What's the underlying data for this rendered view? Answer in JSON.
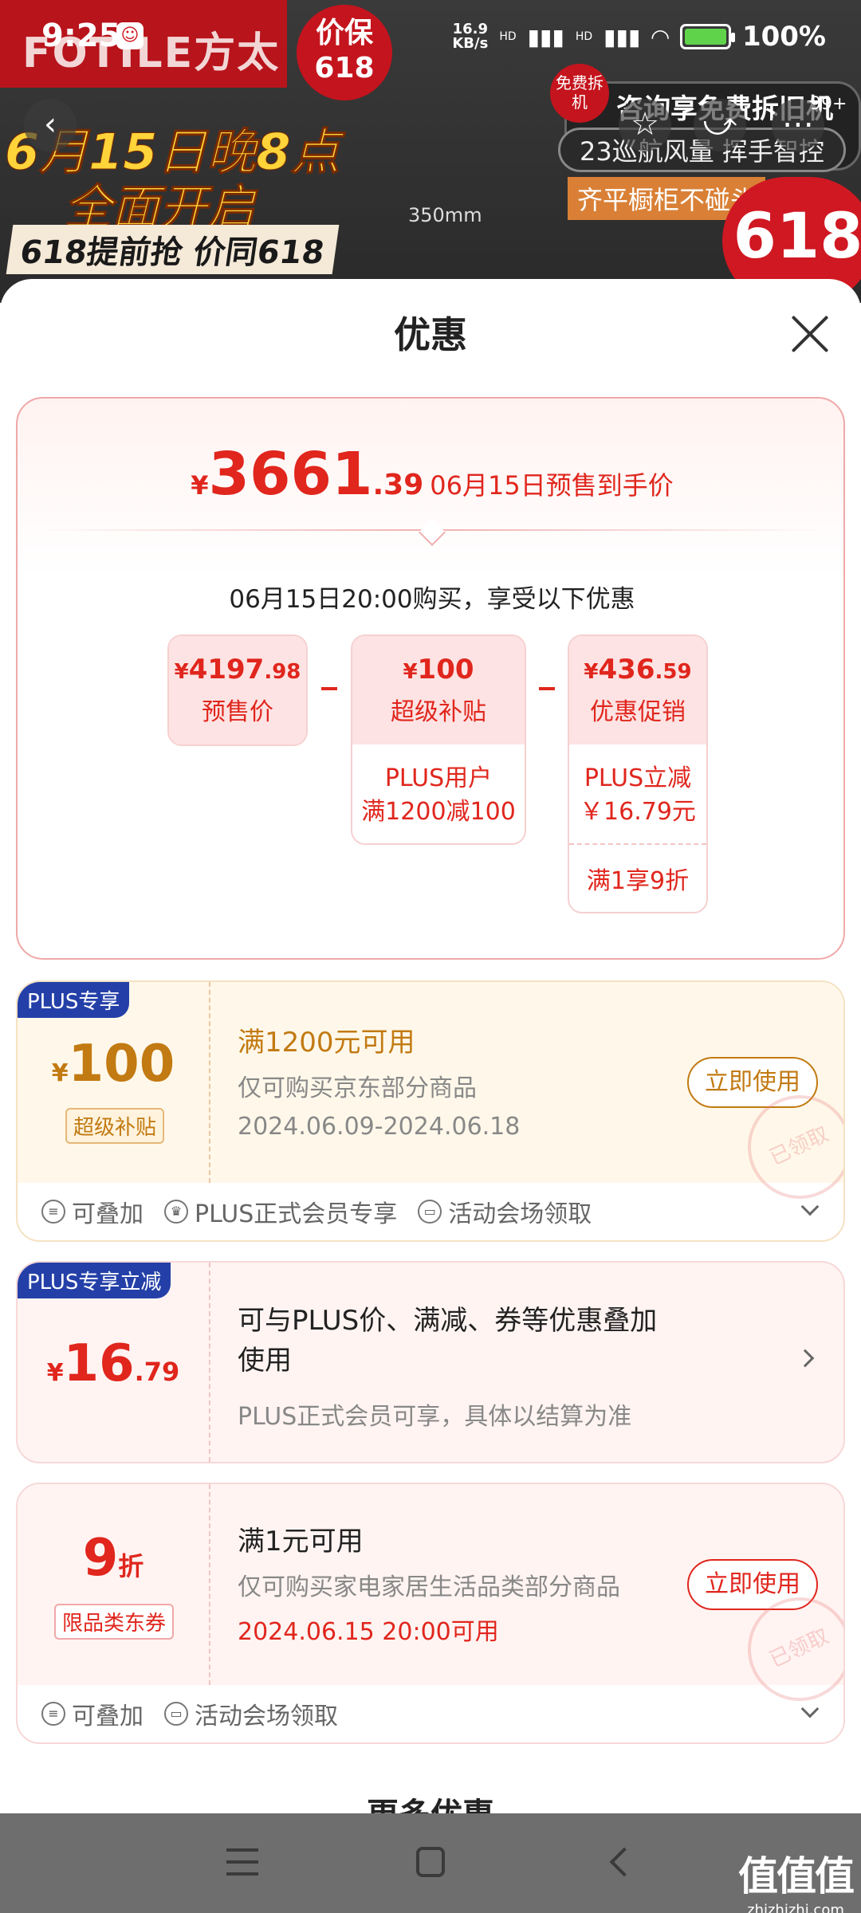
{
  "status_bar": {
    "time": "9:25",
    "net_speed_value": "16.9",
    "net_speed_unit": "KB/s",
    "signal1": "HD",
    "signal2": "HD",
    "battery": "100%",
    "battery_level": 1.0
  },
  "banner": {
    "brand": "FOTILE方太",
    "badge_top": "价保",
    "badge_bottom": "618",
    "date_line": "6月15日晚8点",
    "open_line": "全面开启",
    "sub_line": "618提前抢 价同618",
    "size": "350mm",
    "free_badge": "免费拆机",
    "ad_line1": "咨询享免费拆旧机服务",
    "ad_line2": "23巡航风量 挥手智控",
    "ad_line3": "齐平橱柜不碰头",
    "big_badge": "618",
    "more_badge": "99+"
  },
  "sheet": {
    "title": "优惠"
  },
  "summary": {
    "currency": "¥",
    "price_int": "3661",
    "price_dec": ".39",
    "price_desc": "06月15日预售到手价",
    "buy_note": "06月15日20:00购买，享受以下优惠",
    "presale": {
      "currency": "¥",
      "int": "4197",
      "dec": ".98",
      "label": "预售价"
    },
    "subsidy": {
      "currency": "¥",
      "int": "100",
      "label": "超级补贴",
      "detail_line1": "PLUS用户",
      "detail_line2": "满1200减100"
    },
    "promo": {
      "currency": "¥",
      "int": "436",
      "dec": ".59",
      "label": "优惠促销",
      "detail_line1": "PLUS立减",
      "detail_line2": "￥16.79元",
      "detail2": "满1享9折"
    }
  },
  "coupons": [
    {
      "tag": "PLUS专享",
      "currency": "¥",
      "amount": "100",
      "badge": "超级补贴",
      "title": "满1200元可用",
      "desc": "仅可购买京东部分商品",
      "date": "2024.06.09-2024.06.18",
      "button": "立即使用",
      "stamp": "已领取",
      "footer": [
        "可叠加",
        "PLUS正式会员专享",
        "活动会场领取"
      ]
    },
    {
      "tag": "PLUS专享立减",
      "currency": "¥",
      "amount": "16",
      "amount_dec": ".79",
      "title_line1": "可与PLUS价、满减、券等优惠叠加",
      "title_line2": "使用",
      "desc": "PLUS正式会员可享，具体以结算为准"
    },
    {
      "amount": "9",
      "amount_unit": "折",
      "badge": "限品类东券",
      "title": "满1元可用",
      "desc": "仅可购买家电家居生活品类部分商品",
      "date": "2024.06.15 20:00可用",
      "button": "立即使用",
      "stamp": "已领取",
      "footer": [
        "可叠加",
        "活动会场领取"
      ]
    }
  ],
  "more_title": "更多优惠",
  "watermark": {
    "main": "值值值",
    "sub": "zhizhizhi.com"
  },
  "colors": {
    "accent": "#e0261d",
    "gold": "#c27a12",
    "plus_tag": "#2440a8"
  }
}
